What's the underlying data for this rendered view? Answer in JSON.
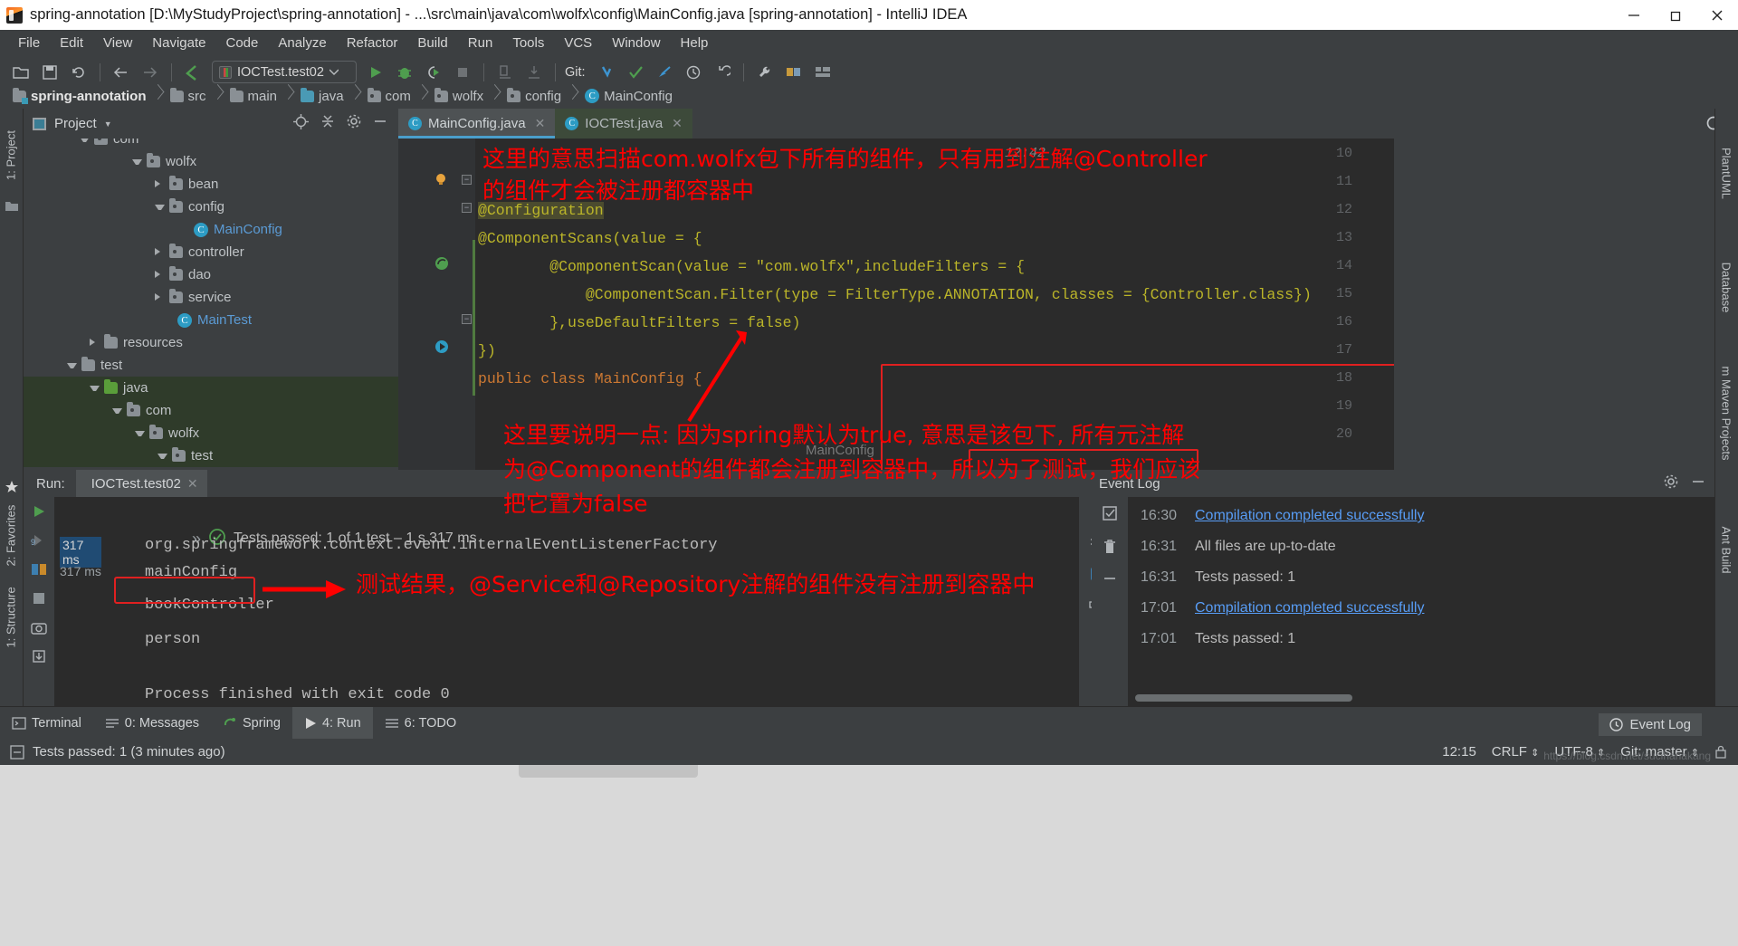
{
  "window": {
    "title": "spring-annotation [D:\\MyStudyProject\\spring-annotation] - ...\\src\\main\\java\\com\\wolfx\\config\\MainConfig.java [spring-annotation] - IntelliJ IDEA",
    "app_icon": "intellij-idea-icon",
    "minimize": "minimize-icon",
    "maximize": "restore-icon",
    "close": "close-icon"
  },
  "menubar": {
    "items": [
      {
        "label": "File"
      },
      {
        "label": "Edit"
      },
      {
        "label": "View"
      },
      {
        "label": "Navigate"
      },
      {
        "label": "Code"
      },
      {
        "label": "Analyze"
      },
      {
        "label": "Refactor"
      },
      {
        "label": "Build"
      },
      {
        "label": "Run"
      },
      {
        "label": "Tools"
      },
      {
        "label": "VCS"
      },
      {
        "label": "Window"
      },
      {
        "label": "Help"
      }
    ]
  },
  "toolbar": {
    "run_configuration": "IOCTest.test02",
    "git_label": "Git:",
    "icons": [
      "open-folder-icon",
      "save-all-icon",
      "sync-icon",
      "back-arrow-icon",
      "forward-arrow-icon",
      "undo-caret-icon",
      "run-icon",
      "debug-icon",
      "run-coverage-icon",
      "stop-icon",
      "profile-icon",
      "import-icon",
      "git-update-icon",
      "git-commit-icon",
      "git-push-icon",
      "history-icon",
      "rollback-icon",
      "settings-wrench-icon",
      "project-structure-icon",
      "layout-icon",
      "search-everywhere-icon"
    ]
  },
  "breadcrumb": {
    "items": [
      {
        "label": "spring-annotation",
        "icon": "module-icon"
      },
      {
        "label": "src",
        "icon": "folder-icon"
      },
      {
        "label": "main",
        "icon": "folder-icon"
      },
      {
        "label": "java",
        "icon": "source-folder-icon"
      },
      {
        "label": "com",
        "icon": "package-icon"
      },
      {
        "label": "wolfx",
        "icon": "package-icon"
      },
      {
        "label": "config",
        "icon": "package-icon"
      },
      {
        "label": "MainConfig",
        "icon": "class-icon"
      }
    ]
  },
  "project_panel": {
    "title": "Project",
    "tools": [
      "target-icon",
      "collapse-all-icon",
      "settings-gear-icon",
      "hide-icon"
    ],
    "tree": [
      {
        "label": "com",
        "indent": 3,
        "arrow": "down",
        "icon": "package-icon",
        "partial": true
      },
      {
        "label": "wolfx",
        "indent": 4,
        "arrow": "down",
        "icon": "package-icon"
      },
      {
        "label": "bean",
        "indent": 5,
        "arrow": "right",
        "icon": "package-icon"
      },
      {
        "label": "config",
        "indent": 5,
        "arrow": "down",
        "icon": "package-icon"
      },
      {
        "label": "MainConfig",
        "indent": 6,
        "arrow": "none",
        "icon": "class-icon",
        "style": "blue"
      },
      {
        "label": "controller",
        "indent": 5,
        "arrow": "right",
        "icon": "package-icon"
      },
      {
        "label": "dao",
        "indent": 5,
        "arrow": "right",
        "icon": "package-icon"
      },
      {
        "label": "service",
        "indent": 5,
        "arrow": "right",
        "icon": "package-icon"
      },
      {
        "label": "MainTest",
        "indent": 5,
        "arrow": "none",
        "icon": "runnable-class-icon",
        "style": "blue"
      },
      {
        "label": "resources",
        "indent": 3,
        "arrow": "right",
        "icon": "resources-folder-icon"
      },
      {
        "label": "test",
        "indent": 2,
        "arrow": "down",
        "icon": "folder-icon"
      },
      {
        "label": "java",
        "indent": 3,
        "arrow": "down",
        "icon": "test-source-folder-icon",
        "selected": true
      },
      {
        "label": "com",
        "indent": 4,
        "arrow": "down",
        "icon": "package-icon",
        "selected": true
      },
      {
        "label": "wolfx",
        "indent": 5,
        "arrow": "down",
        "icon": "package-icon",
        "selected": true
      },
      {
        "label": "test",
        "indent": 6,
        "arrow": "down",
        "icon": "package-icon",
        "selected": true
      }
    ]
  },
  "editor": {
    "tabs": [
      {
        "label": "MainConfig.java",
        "icon": "class-icon",
        "active": true
      },
      {
        "label": "IOCTest.java",
        "icon": "class-icon",
        "active": false
      }
    ],
    "line_numbers": [
      "10",
      "11",
      "12",
      "13",
      "14",
      "15",
      "16",
      "17",
      "18",
      "19",
      "20"
    ],
    "code": [
      {
        "line": "10",
        "text": "",
        "annotation_overlay": true
      },
      {
        "line": "11",
        "text": ""
      },
      {
        "line": "12",
        "text": "@Configuration"
      },
      {
        "line": "13",
        "text": "@ComponentScans(value = {"
      },
      {
        "line": "14",
        "text": "        @ComponentScan(value = \"com.wolfx\",includeFilters = {"
      },
      {
        "line": "15",
        "text": "            @ComponentScan.Filter(type = FilterType.ANNOTATION, classes = {Controller.class})"
      },
      {
        "line": "16",
        "text": "        },useDefaultFilters = false)"
      },
      {
        "line": "17",
        "text": "})"
      },
      {
        "line": "18",
        "text": "public class MainConfig {"
      },
      {
        "line": "19",
        "text": ""
      },
      {
        "line": "20",
        "text": ""
      }
    ],
    "timestamp_hint": "12:42",
    "class_hint": "MainConfig",
    "highlighted_token": "useDefaultFilters = false"
  },
  "annotations": {
    "note1_line1": "这里的意思扫描com.wolfx包下所有的组件，只有用到注解@Controller",
    "note1_line2": "的组件才会被注册都容器中",
    "note2_line1": "这里要说明一点: 因为spring默认为true, 意思是该包下, 所有元注解",
    "note2_line2": "为@Component的组件都会注册到容器中，所以为了测试，我们应该",
    "note2_line3": "把它置为false",
    "note3": "测试结果，@Service和@Repository注解的组件没有注册到容器中"
  },
  "run_panel": {
    "label": "Run:",
    "tab": "IOCTest.test02",
    "status": "Tests passed: 1 of 1 test – 1 s 317 ms",
    "status_icon": "tests-passed-icon",
    "expand_icon": "chevron-double-right-icon",
    "timings": [
      "317 ms",
      "317 ms"
    ],
    "console_lines": [
      "org.springframework.context.event.internalEventListenerFactory",
      "mainConfig",
      "bookController",
      "person",
      "",
      "Process finished with exit code 0"
    ],
    "left_tools": [
      "rerun-icon",
      "rerun-failed-icon",
      "toggle-auto-test-icon",
      "stop-icon",
      "camera-icon",
      "export-icon"
    ],
    "right_tools": [
      "scroll-up-icon",
      "soft-wrap-icon",
      "scroll-to-end-icon",
      "print-icon",
      "clear-all-icon"
    ]
  },
  "event_log": {
    "title": "Event Log",
    "tools": [
      "settings-gear-icon",
      "hide-icon"
    ],
    "side_tools": [
      "mark-read-icon",
      "delete-icon",
      "collapse-icon"
    ],
    "entries": [
      {
        "time": "16:30",
        "text": "Compilation completed successfully",
        "link": true
      },
      {
        "time": "16:31",
        "text": "All files are up-to-date",
        "link": false
      },
      {
        "time": "16:31",
        "text": "Tests passed: 1",
        "link": false
      },
      {
        "time": "17:01",
        "text": "Compilation completed successfully",
        "link": true
      },
      {
        "time": "17:01",
        "text": "Tests passed: 1",
        "link": false
      }
    ]
  },
  "bottom_bar": {
    "items": [
      {
        "label": "Terminal",
        "icon": "terminal-icon",
        "active": false
      },
      {
        "label": "0: Messages",
        "icon": "messages-icon",
        "active": false
      },
      {
        "label": "Spring",
        "icon": "spring-icon",
        "active": false
      },
      {
        "label": "4: Run",
        "icon": "run-icon",
        "active": true
      },
      {
        "label": "6: TODO",
        "icon": "todo-icon",
        "active": false
      }
    ],
    "event_log_button": "Event Log"
  },
  "left_rail": {
    "items": [
      "1: Project",
      "2: Favorites",
      "1: Structure"
    ]
  },
  "right_rail": {
    "items": [
      "PlantUML",
      "Database",
      "m Maven Projects",
      "Ant Build"
    ]
  },
  "status_bar": {
    "message": "Tests passed: 1 (3 minutes ago)",
    "message_icon": "info-icon",
    "time": "12:15",
    "line_separator": "CRLF",
    "encoding": "UTF-8",
    "branch": "Git: master",
    "lock_icon": "lock-icon"
  },
  "watermark": "https://blog.csdn.net/sucihanakang",
  "colors": {
    "accent_blue": "#4a9ecb",
    "annotation_red": "#ff0000",
    "editor_bg": "#2b2b2b",
    "panel_bg": "#3c3f41",
    "link_blue": "#589df6",
    "selection_green": "#2f3b2a"
  }
}
